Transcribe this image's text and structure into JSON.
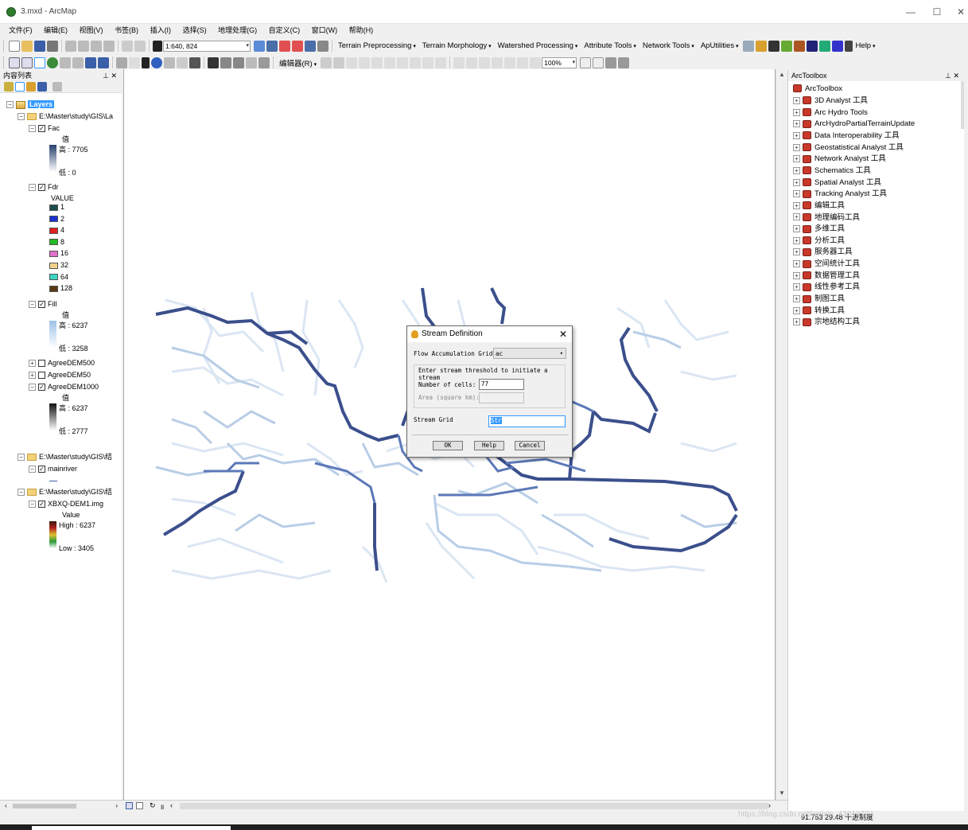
{
  "window": {
    "title": "3.mxd - ArcMap",
    "controls": [
      "—",
      "☐",
      "✕"
    ]
  },
  "menu": [
    "文件(F)",
    "编辑(E)",
    "视图(V)",
    "书签(B)",
    "插入(I)",
    "选择(S)",
    "地理处理(G)",
    "自定义(C)",
    "窗口(W)",
    "帮助(H)"
  ],
  "toolbar": {
    "scale": "1:640, 824",
    "arc_hydro_menus": [
      "Terrain Preprocessing",
      "Terrain Morphology",
      "Watershed Processing",
      "Attribute Tools",
      "Network Tools",
      "ApUtilities"
    ],
    "help": "Help",
    "editor": "编辑器(R)",
    "zoom_level": "100%"
  },
  "toc": {
    "title": "内容列表",
    "root": "Layers",
    "group1_path": "E:\\Master\\study\\GIS\\La",
    "fac": {
      "name": "Fac",
      "value_label": "值",
      "high": "高 : 7705",
      "low": "低 : 0"
    },
    "fdr": {
      "name": "Fdr",
      "value_label": "VALUE",
      "classes": [
        {
          "label": "1",
          "color": "#1f4e4e"
        },
        {
          "label": "2",
          "color": "#1a2fd1"
        },
        {
          "label": "4",
          "color": "#e02020"
        },
        {
          "label": "8",
          "color": "#22bb22"
        },
        {
          "label": "16",
          "color": "#e070c8"
        },
        {
          "label": "32",
          "color": "#f2d28a"
        },
        {
          "label": "64",
          "color": "#3ad6c4"
        },
        {
          "label": "128",
          "color": "#5a3a12"
        }
      ]
    },
    "fill": {
      "name": "Fill",
      "value_label": "值",
      "high": "高 : 6237",
      "low": "低 : 3258"
    },
    "agree500": "AgreeDEM500",
    "agree50": "AgreeDEM50",
    "agree1000": {
      "name": "AgreeDEM1000",
      "value_label": "值",
      "high": "高 : 6237",
      "low": "低 : 2777"
    },
    "group2_path": "E:\\Master\\study\\GIS\\结",
    "mainriver": "mainriver",
    "group3_path": "E:\\Master\\study\\GIS\\结",
    "dem": {
      "name": "XBXQ-DEM1.img",
      "value_label": "Value",
      "high": "High : 6237",
      "low": "Low : 3405"
    }
  },
  "toolbox": {
    "title": "ArcToolbox",
    "root": "ArcToolbox",
    "items": [
      "3D Analyst 工具",
      "Arc Hydro Tools",
      "ArcHydroPartialTerrainUpdate",
      "Data Interoperability 工具",
      "Geostatistical Analyst 工具",
      "Network Analyst 工具",
      "Schematics 工具",
      "Spatial Analyst 工具",
      "Tracking Analyst 工具",
      "编辑工具",
      "地理编码工具",
      "多维工具",
      "分析工具",
      "服务器工具",
      "空间统计工具",
      "数据管理工具",
      "线性参考工具",
      "制图工具",
      "转换工具",
      "宗地结构工具"
    ]
  },
  "dialog": {
    "title": "Stream Definition",
    "flow_acc_label": "Flow Accumulation Grid",
    "flow_acc_value": "ac",
    "threshold_caption": "Enter stream threshold to initiate a stream",
    "cells_label": "Number of cells:",
    "cells_value": "77",
    "area_label": "Area (square km):",
    "area_value": "",
    "stream_grid_label": "Stream Grid",
    "stream_grid_value": "Str",
    "ok": "OK",
    "help": "Help",
    "cancel": "Cancel"
  },
  "status": {
    "coords": "91.753  29.48 十进制度",
    "watermark": "https://blog.csdn.net/weixin_43012724"
  }
}
